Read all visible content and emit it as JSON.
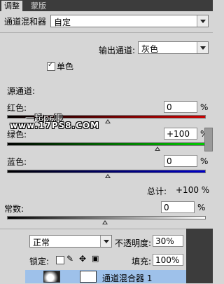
{
  "tabs": [
    "调整",
    "蒙版"
  ],
  "header": {
    "label": "通道混和器",
    "preset": "自定"
  },
  "output_channel": {
    "label": "输出通道:",
    "value": "灰色"
  },
  "monochrome": {
    "label": "单色",
    "checked": true
  },
  "source_channels_label": "源通道:",
  "channels": [
    {
      "name": "红色:",
      "value": "0",
      "unit": "%"
    },
    {
      "name": "绿色:",
      "value": "+100",
      "unit": "%"
    },
    {
      "name": "蓝色:",
      "value": "0",
      "unit": "%"
    }
  ],
  "total": {
    "label": "总计:",
    "value": "+100 %"
  },
  "constant": {
    "label": "常数:",
    "value": "0",
    "unit": "%"
  },
  "watermark": {
    "line1": "一起ps吧",
    "line2": "www.17PS8.COM"
  },
  "layers": {
    "blend_mode": "正常",
    "opacity_label": "不透明度:",
    "opacity_value": "30%",
    "lock_label": "锁定:",
    "fill_label": "填充:",
    "fill_value": "100%",
    "layer_name": "通道混合器 1"
  }
}
